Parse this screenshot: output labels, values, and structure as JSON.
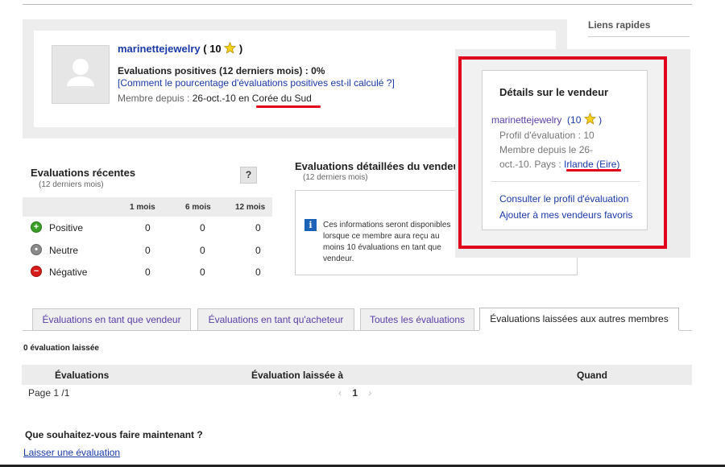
{
  "quick_links": {
    "title": "Liens rapides"
  },
  "profile": {
    "username": "marinettejewelry",
    "score": "10",
    "positive_label": "Evaluations positives (12 derniers mois) : 0%",
    "calc_link": "[Comment le pourcentage d'évaluations positives est-il calculé ?]",
    "member_since_label": "Membre depuis :",
    "member_since_date": "26-oct.-10 en",
    "country": "Corée du Sud"
  },
  "recent": {
    "title": "Evaluations récentes",
    "subtitle": "(12 derniers mois)",
    "help": "?",
    "columns": [
      "1 mois",
      "6 mois",
      "12 mois"
    ],
    "rows": [
      {
        "label": "Positive",
        "icon": "plus",
        "values": [
          "0",
          "0",
          "0"
        ]
      },
      {
        "label": "Neutre",
        "icon": "circle",
        "values": [
          "0",
          "0",
          "0"
        ]
      },
      {
        "label": "Négative",
        "icon": "minus",
        "values": [
          "0",
          "0",
          "0"
        ]
      }
    ]
  },
  "detailed": {
    "title": "Evaluations détaillées du vendeur",
    "subtitle": "(12 derniers mois)",
    "info_text": "Ces informations seront disponibles lorsque ce membre aura reçu au moins 10 évaluations en tant que vendeur."
  },
  "seller_popup": {
    "title": "Détails sur le vendeur",
    "username": "marinettejewelry",
    "score": "(10",
    "close_paren": ")",
    "profile_label": "Profil d'évaluation : 10",
    "member_line1": "Membre depuis le 26-",
    "member_line2_prefix": "oct.-10. Pays :",
    "country": "Irlande (Eire)",
    "link_profile": "Consulter le profil d'évaluation",
    "link_favorites": "Ajouter à mes vendeurs favoris"
  },
  "tabs": [
    {
      "label": "Évaluations en tant que vendeur",
      "active": false
    },
    {
      "label": "Évaluations en tant qu'acheteur",
      "active": false
    },
    {
      "label": "Toutes les évaluations",
      "active": false
    },
    {
      "label": "Évaluations laissées aux autres membres",
      "active": true
    }
  ],
  "feedback_list": {
    "count_label": "0 évaluation laissée",
    "columns": [
      "Évaluations",
      "Évaluation laissée à",
      "Quand"
    ],
    "page_info": "Page 1 /1",
    "current_page": "1"
  },
  "actions": {
    "question": "Que souhaitez-vous faire maintenant ?",
    "leave_link": "Laisser une évaluation"
  },
  "colors": {
    "highlight_red": "#e0001b",
    "link_blue": "#1a3aa8",
    "tab_purple": "#5a3ea6",
    "star_yellow": "#f4d21f"
  }
}
